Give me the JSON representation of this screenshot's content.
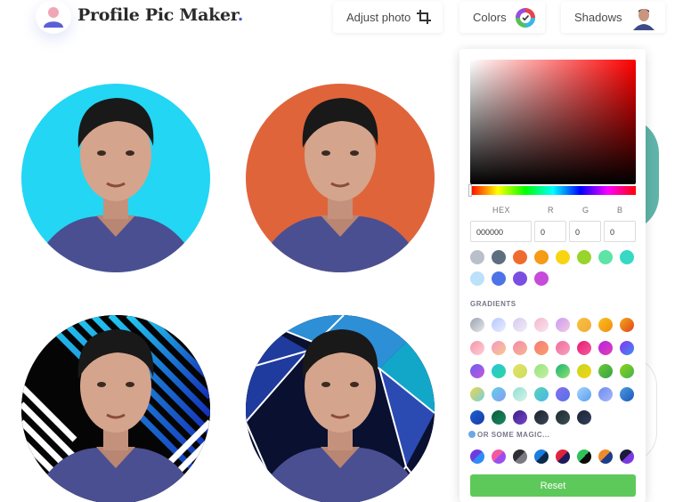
{
  "header": {
    "brand": "Profile Pic Maker",
    "brand_dot": ".",
    "adjust_label": "Adjust photo",
    "colors_label": "Colors",
    "shadows_label": "Shadows"
  },
  "avatars": [
    {
      "style": "solid",
      "color": "#22d6f4"
    },
    {
      "style": "solid",
      "color": "#e0643a"
    },
    {
      "style": "stripes",
      "color": "#1b8ec8"
    },
    {
      "style": "polygon",
      "color": "#0b1236"
    }
  ],
  "color_panel": {
    "labels": {
      "hex": "HEX",
      "r": "R",
      "g": "G",
      "b": "B"
    },
    "values": {
      "hex": "000000",
      "r": "0",
      "g": "0",
      "b": "0"
    },
    "solid_colors": [
      "#b9c0cc",
      "#5d6e80",
      "#ef6c2f",
      "#f59b15",
      "#f8d511",
      "#98d42b",
      "#5de4a6",
      "#35d9c4",
      "#bbe1fb",
      "#4d74e6",
      "#7a4fe0",
      "#c64bda"
    ],
    "gradients_label": "GRADIENTS",
    "gradients": [
      [
        "#9aa3ad",
        "#e6e8ec"
      ],
      [
        "#b8c7ff",
        "#e9edff"
      ],
      [
        "#d6c9f0",
        "#f2edf8"
      ],
      [
        "#f4b7cd",
        "#f8e6ef"
      ],
      [
        "#c99cf4",
        "#f3c8e2"
      ],
      [
        "#f7c23e",
        "#f3a93a"
      ],
      [
        "#f9c31c",
        "#f38a11"
      ],
      [
        "#f2aa16",
        "#e1431e"
      ],
      [
        "#f695a8",
        "#fbd1d9"
      ],
      [
        "#f497c6",
        "#f8c98a"
      ],
      [
        "#f48bab",
        "#f7b58f"
      ],
      [
        "#f77a7a",
        "#f9a06b"
      ],
      [
        "#f26a9a",
        "#f6a1c0"
      ],
      [
        "#e9196d",
        "#f45ca2"
      ],
      [
        "#b224e4",
        "#e43fb0"
      ],
      [
        "#8a34ee",
        "#3b8ef5"
      ],
      [
        "#6b5ef0",
        "#c558de"
      ],
      [
        "#2ac4d6",
        "#28d8a2"
      ],
      [
        "#e5e06a",
        "#c8e05a"
      ],
      [
        "#95e27f",
        "#c7f0a0"
      ],
      [
        "#18b27c",
        "#92e266"
      ],
      [
        "#c6d61e",
        "#f7d417"
      ],
      [
        "#6dc93a",
        "#33a245"
      ],
      [
        "#90d21a",
        "#3fb44a"
      ],
      [
        "#f3d543",
        "#71d0e4"
      ],
      [
        "#5fd0e6",
        "#8a9cf3"
      ],
      [
        "#8fe0d1",
        "#d7f3ea"
      ],
      [
        "#5ad2b8",
        "#46b8e8"
      ],
      [
        "#8c6bf1",
        "#4f74e6"
      ],
      [
        "#a2d6f9",
        "#5b9bf2"
      ],
      [
        "#6d8cf1",
        "#a7b7f8"
      ],
      [
        "#4d9bdc",
        "#1c57bf"
      ],
      [
        "#1c5fd0",
        "#1a3ba5"
      ],
      [
        "#0e5a3a",
        "#178a63"
      ],
      [
        "#3a1f86",
        "#7846c9"
      ],
      [
        "#1b2430",
        "#3a4656"
      ],
      [
        "#1c2a2e",
        "#3b5058"
      ],
      [
        "#1b2436",
        "#32405a"
      ]
    ],
    "magic_label": "OR SOME MAGIC...",
    "magic": [
      [
        "#6c3ce0",
        "#2e8cf5"
      ],
      [
        "#f25aa0",
        "#9b4ef0"
      ],
      [
        "#2e2e33",
        "#7a7a82"
      ],
      [
        "#1a7de0",
        "#0b2a4a"
      ],
      [
        "#e0243b",
        "#1f1b5a"
      ],
      [
        "#2ec25a",
        "#0b0b0b"
      ],
      [
        "#f08a2a",
        "#1e3d88"
      ],
      [
        "#1b1b3a",
        "#7b3ae0"
      ]
    ],
    "reset_label": "Reset",
    "accent": "#5ec95b"
  }
}
